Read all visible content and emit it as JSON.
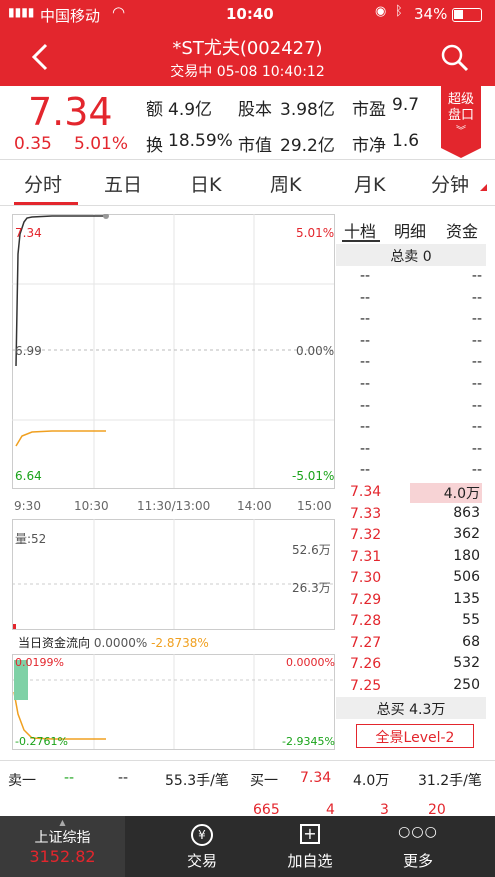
{
  "status": {
    "carrier": "中国移动",
    "time": "10:40",
    "battery": "34%"
  },
  "nav": {
    "title": "*ST尤夫(002427)",
    "subtitle": "交易中 05-08 10:40:12"
  },
  "quote": {
    "price": "7.34",
    "change": "0.35",
    "change_pct": "5.01%",
    "labels": [
      "额",
      "股本",
      "市盈",
      "换",
      "市值",
      "市净"
    ],
    "values": [
      "4.9亿",
      "3.98亿",
      "9.7",
      "18.59%",
      "29.2亿",
      "1.6"
    ],
    "super_button": [
      "超级",
      "盘口"
    ]
  },
  "tabs": [
    "分时",
    "五日",
    "日K",
    "周K",
    "月K",
    "分钟"
  ],
  "chart_labels": {
    "p_high": "7.34",
    "p_mid": "6.99",
    "p_low": "6.64",
    "pct_high": "5.01%",
    "pct_mid": "0.00%",
    "pct_low": "-5.01%",
    "times": [
      "9:30",
      "10:30",
      "11:30/13:00",
      "14:00",
      "15:00"
    ],
    "vol_label": "量:52",
    "vol_hi": "52.6万",
    "vol_mid": "26.3万",
    "flow_title": "当日资金流向",
    "flow_v1": "0.0000%",
    "flow_v2": "-2.8738%",
    "flow_top_l": "0.0199%",
    "flow_top_r": "0.0000%",
    "flow_bot_l": "-0.2761%",
    "flow_bot_r": "-2.9345%"
  },
  "book": {
    "tabs": [
      "十档",
      "明细",
      "资金"
    ],
    "total_sell": "总卖 0",
    "dash": "--",
    "bids": [
      {
        "p": "7.34",
        "v": "4.0万"
      },
      {
        "p": "7.33",
        "v": "863"
      },
      {
        "p": "7.32",
        "v": "362"
      },
      {
        "p": "7.31",
        "v": "180"
      },
      {
        "p": "7.30",
        "v": "506"
      },
      {
        "p": "7.29",
        "v": "135"
      },
      {
        "p": "7.28",
        "v": "55"
      },
      {
        "p": "7.27",
        "v": "68"
      },
      {
        "p": "7.26",
        "v": "532"
      },
      {
        "p": "7.25",
        "v": "250"
      }
    ],
    "total_buy": "总买 4.3万",
    "level2": "全景Level-2"
  },
  "bottom": {
    "sell1": "卖一",
    "s_dash1": "--",
    "s_dash2": "--",
    "s_avg": "55.3手/笔",
    "buy1": "买一",
    "b_price": "7.34",
    "b_vol": "4.0万",
    "b_avg": "31.2手/笔",
    "partial": [
      "665",
      "4",
      "3",
      "20"
    ]
  },
  "footer": {
    "index_name": "上证综指",
    "index_value": "3152.82",
    "items": [
      "交易",
      "加自选",
      "更多"
    ]
  }
}
